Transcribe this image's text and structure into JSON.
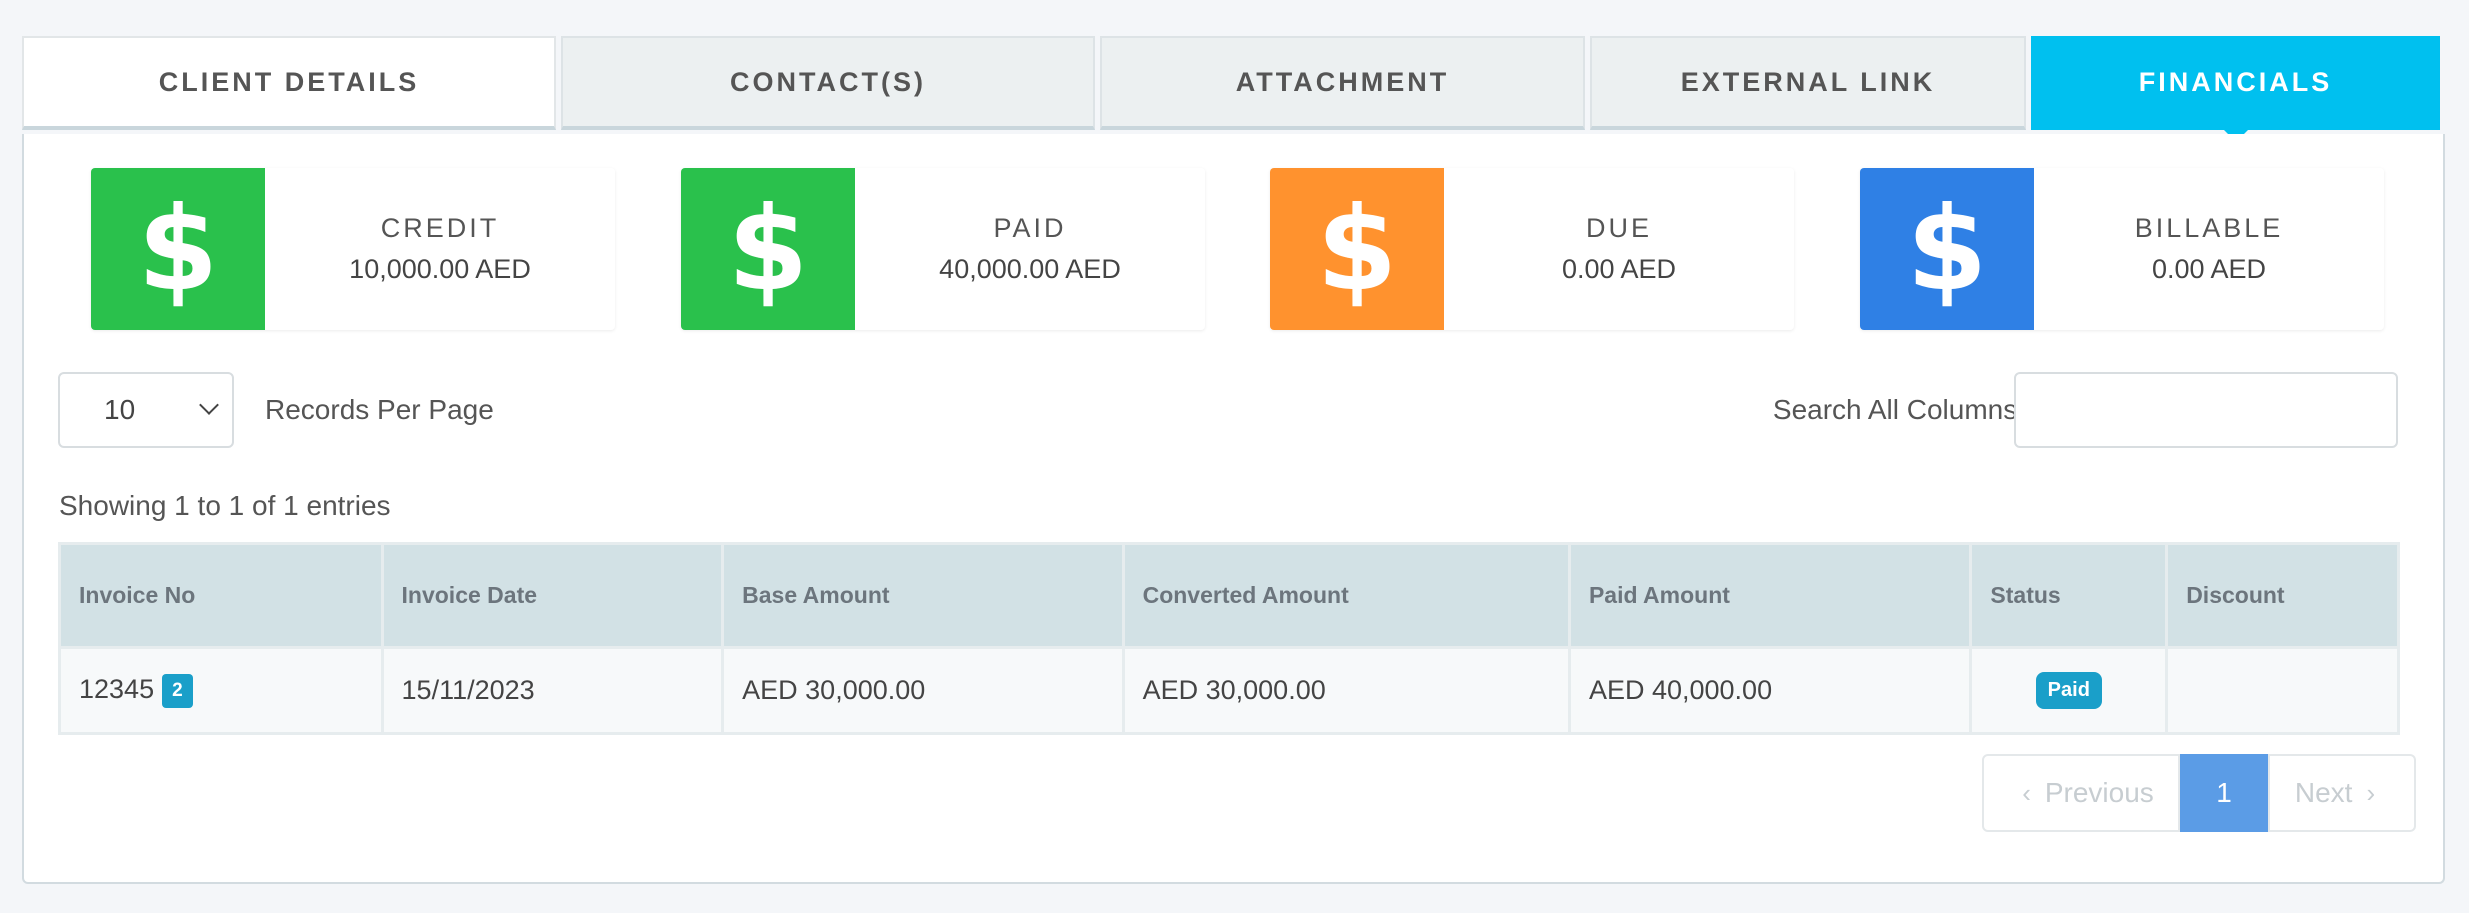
{
  "tabs": [
    {
      "label": "CLIENT DETAILS"
    },
    {
      "label": "CONTACT(S)"
    },
    {
      "label": "ATTACHMENT"
    },
    {
      "label": "EXTERNAL LINK"
    },
    {
      "label": "FINANCIALS"
    }
  ],
  "summary": [
    {
      "label": "CREDIT",
      "value": "10,000.00 AED",
      "icon": "dollar-icon",
      "color": "#2ac14c"
    },
    {
      "label": "PAID",
      "value": "40,000.00 AED",
      "icon": "dollar-icon",
      "color": "#2ac14c"
    },
    {
      "label": "DUE",
      "value": "0.00 AED",
      "icon": "dollar-icon",
      "color": "#ff922e"
    },
    {
      "label": "BILLABLE",
      "value": "0.00 AED",
      "icon": "dollar-icon",
      "color": "#2f80e5"
    }
  ],
  "icon_glyph": "$",
  "controls": {
    "per_page_value": "10",
    "per_page_label": "Records Per Page",
    "search_label": "Search All Columns:",
    "search_value": ""
  },
  "showing": "Showing 1 to 1 of 1 entries",
  "table": {
    "headers": [
      "Invoice No",
      "Invoice Date",
      "Base Amount",
      "Converted Amount",
      "Paid Amount",
      "Status",
      "Discount"
    ],
    "rows": [
      {
        "invoice_no": "12345",
        "count_badge": "2",
        "invoice_date": "15/11/2023",
        "base_amount": "AED 30,000.00",
        "converted_amount": "AED 30,000.00",
        "paid_amount": "AED 40,000.00",
        "status": "Paid",
        "discount": ""
      }
    ]
  },
  "pagination": {
    "previous": "Previous",
    "current": "1",
    "next": "Next",
    "prev_icon": "‹",
    "next_icon": "›"
  },
  "colors": {
    "active_tab": "#00c0ef",
    "badge": "#1a9fc9",
    "current_page": "#5b9ce6"
  }
}
